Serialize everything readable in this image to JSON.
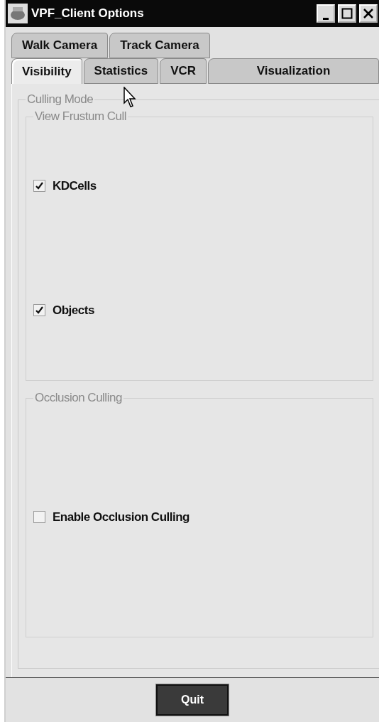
{
  "window": {
    "title": "VPF_Client Options"
  },
  "tab_rows": [
    [
      {
        "label": "Walk Camera",
        "selected": false
      },
      {
        "label": "Track Camera",
        "selected": false
      }
    ],
    [
      {
        "label": "Visibility",
        "selected": true
      },
      {
        "label": "Statistics",
        "selected": false
      },
      {
        "label": "VCR",
        "selected": false
      },
      {
        "label": "Visualization",
        "selected": false
      }
    ]
  ],
  "culling_mode": {
    "title": "Culling Mode",
    "groups": [
      {
        "title": "View Frustum Cull",
        "options": [
          {
            "label": "KDCells",
            "checked": true
          },
          {
            "label": "Objects",
            "checked": true
          }
        ]
      },
      {
        "title": "Occlusion Culling",
        "options": [
          {
            "label": "Enable Occlusion Culling",
            "checked": false
          }
        ]
      }
    ]
  },
  "buttons": [
    {
      "label": "Quit"
    }
  ]
}
